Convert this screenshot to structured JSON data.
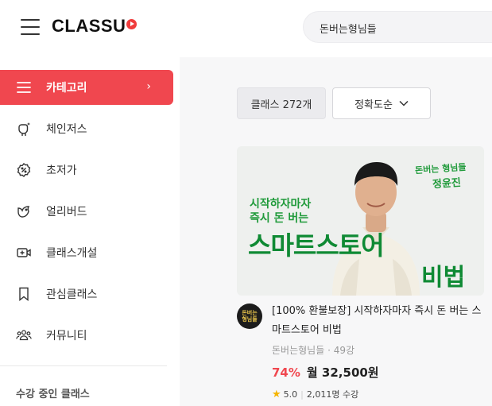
{
  "header": {
    "logo_text": "CLASSU",
    "search_value": "돈버는형님들",
    "brand_color": "#f0474f"
  },
  "sidebar": {
    "items": [
      {
        "label": "카테고리",
        "icon": "menu-icon",
        "active": true
      },
      {
        "label": "체인저스",
        "icon": "sparkle-person-icon"
      },
      {
        "label": "초저가",
        "icon": "discount-badge-icon"
      },
      {
        "label": "얼리버드",
        "icon": "bird-icon"
      },
      {
        "label": "클래스개설",
        "icon": "video-plus-icon"
      },
      {
        "label": "관심클래스",
        "icon": "bookmark-icon"
      },
      {
        "label": "커뮤니티",
        "icon": "community-icon"
      }
    ],
    "section_title": "수강 중인 클래스"
  },
  "main": {
    "count_label": "클래스 272개",
    "sort_label": "정확도순",
    "card": {
      "thumb": {
        "headline1": "시작하자마자",
        "headline2": "즉시 돈 버는",
        "big1": "스마트스토어",
        "big2": "비법",
        "sig1": "돈버는 형님들",
        "sig2": "정윤진"
      },
      "avatar_line1": "돈버는",
      "avatar_line2": "형님들",
      "title": "[100% 환불보장] 시작하자마자 즉시 돈 버는 스마트스토어 비법",
      "creator": "돈버는형님들",
      "lessons": "49강",
      "discount": "74%",
      "price": "월 32,500원",
      "rating": "5.0",
      "students": "2,011명 수강"
    }
  }
}
